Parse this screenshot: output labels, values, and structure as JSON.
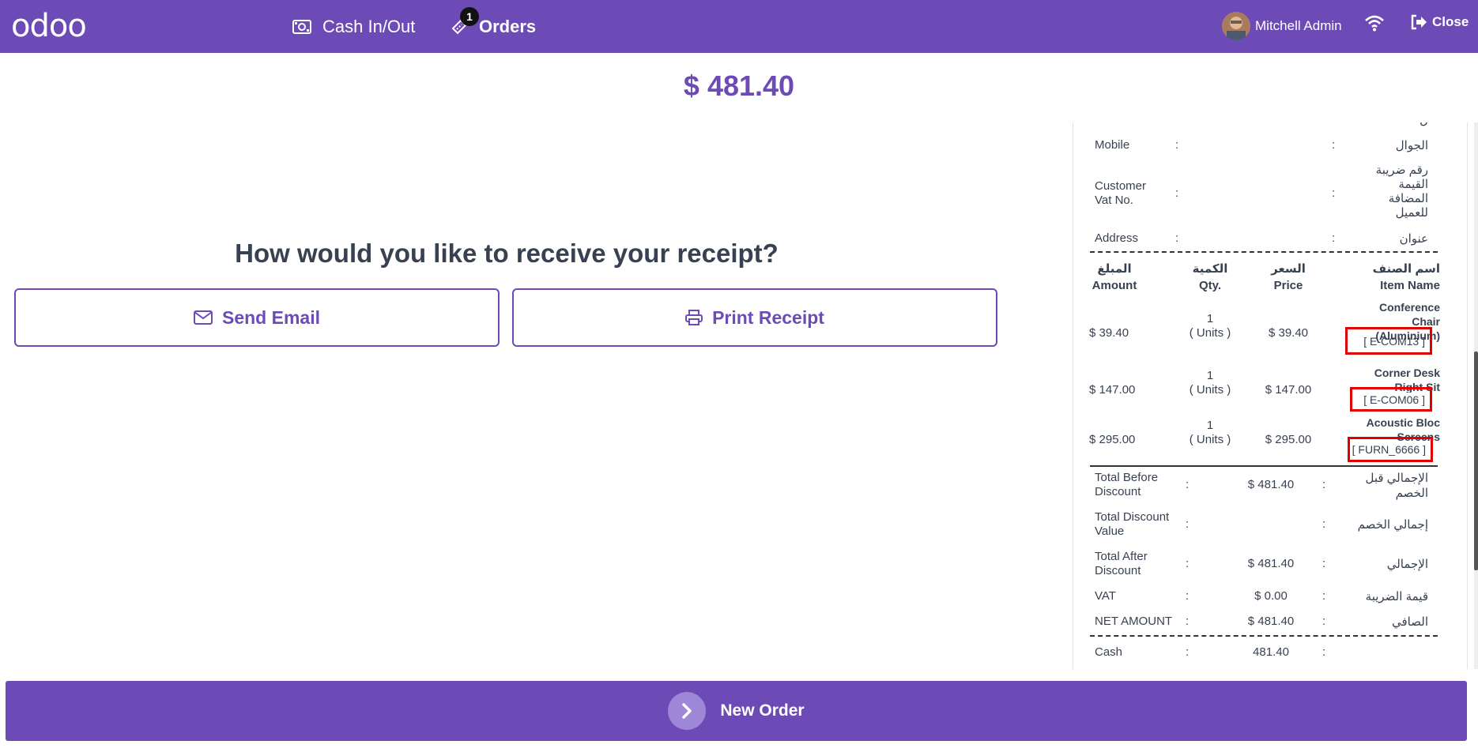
{
  "header": {
    "logo": "odoo",
    "cash_label": "Cash In/Out",
    "orders_label": "Orders",
    "orders_badge": "1",
    "user_name": "Mitchell Admin",
    "close_label": "Close"
  },
  "amount": "$ 481.40",
  "prompt": "How would you like to receive your receipt?",
  "buttons": {
    "email": "Send Email",
    "print": "Print Receipt",
    "new_order": "New Order"
  },
  "receipt": {
    "partial_top": "ل",
    "customer_fields": [
      {
        "en": "Mobile",
        "ar": "الجوال"
      },
      {
        "en": "Customer Vat No.",
        "ar": "رقم ضريبة القيمة المضافة للعميل"
      },
      {
        "en": "Address",
        "ar": "عنوان"
      }
    ],
    "headers": {
      "amount_ar": "المبلغ",
      "amount_en": "Amount",
      "qty_ar": "الكمية",
      "qty_en": "Qty.",
      "price_ar": "السعر",
      "price_en": "Price",
      "name_ar": "اسم الصنف",
      "name_en": "Item Name"
    },
    "items": [
      {
        "amount": "$ 39.40",
        "qty": "1",
        "unit": "( Units )",
        "price": "$ 39.40",
        "name": "Conference Chair (Aluminium)",
        "code": "[ E-COM13 ]"
      },
      {
        "amount": "$ 147.00",
        "qty": "1",
        "unit": "( Units )",
        "price": "$ 147.00",
        "name": "Corner Desk Right Sit",
        "code": "[ E-COM06 ]"
      },
      {
        "amount": "$ 295.00",
        "qty": "1",
        "unit": "( Units )",
        "price": "$ 295.00",
        "name": "Acoustic Bloc Screens",
        "code": "[ FURN_6666 ]"
      }
    ],
    "totals": [
      {
        "en": "Total Before Discount",
        "value": "$ 481.40",
        "ar": "الإجمالي قبل الخصم"
      },
      {
        "en": "Total Discount Value",
        "value": "",
        "ar": "إجمالي الخصم"
      },
      {
        "en": "Total After Discount",
        "value": "$ 481.40",
        "ar": "الإجمالي"
      },
      {
        "en": "VAT",
        "value": "$ 0.00",
        "ar": "قيمة الضريبة"
      },
      {
        "en": "NET AMOUNT",
        "value": "$ 481.40",
        "ar": "الصافي"
      }
    ],
    "payment": {
      "en": "Cash",
      "value": "481.40"
    },
    "colon": ":"
  },
  "colors": {
    "brand": "#6d4bb6",
    "highlight": "#e00000"
  }
}
